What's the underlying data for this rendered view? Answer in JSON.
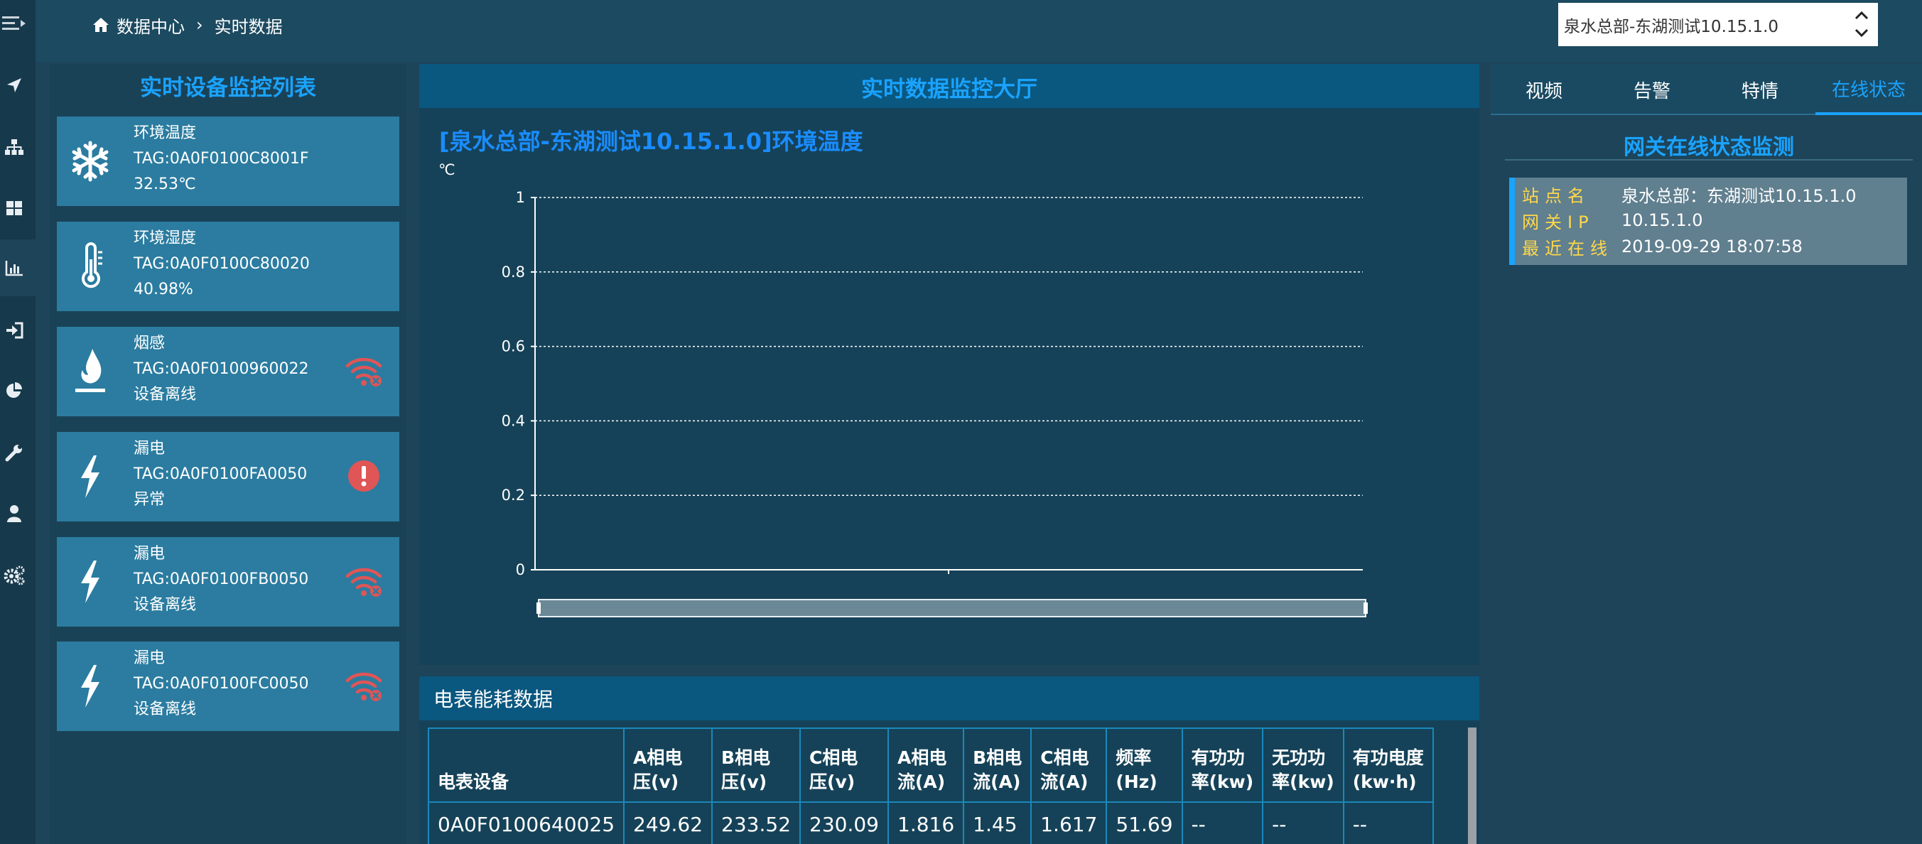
{
  "breadcrumb": {
    "home": "数据中心",
    "sep": "›",
    "current": "实时数据"
  },
  "site_select": {
    "value": "泉水总部-东湖测试10.15.1.0"
  },
  "device_list": {
    "title": "实时设备监控列表",
    "items": [
      {
        "name": "环境温度",
        "tag": "TAG:0A0F0100C8001F",
        "value": "32.53℃",
        "icon": "snowflake-icon",
        "status": ""
      },
      {
        "name": "环境湿度",
        "tag": "TAG:0A0F0100C80020",
        "value": "40.98%",
        "icon": "thermometer-icon",
        "status": ""
      },
      {
        "name": "烟感",
        "tag": "TAG:0A0F0100960022",
        "value": "设备离线",
        "icon": "flame-icon",
        "status": "wifi-off-icon"
      },
      {
        "name": "漏电",
        "tag": "TAG:0A0F0100FA0050",
        "value": "异常",
        "icon": "bolt-icon",
        "status": "alert-icon"
      },
      {
        "name": "漏电",
        "tag": "TAG:0A0F0100FB0050",
        "value": "设备离线",
        "icon": "bolt-icon",
        "status": "wifi-off-icon"
      },
      {
        "name": "漏电",
        "tag": "TAG:0A0F0100FC0050",
        "value": "设备离线",
        "icon": "bolt-icon",
        "status": "wifi-off-icon"
      }
    ]
  },
  "monitor": {
    "title": "实时数据监控大厅",
    "chart_title": "[泉水总部-东湖测试10.15.1.0]环境温度"
  },
  "chart_data": {
    "type": "line",
    "title": "",
    "ylabel": "℃",
    "xlabel": "",
    "ylim": [
      0,
      1
    ],
    "yticks": [
      "0",
      "0.2",
      "0.4",
      "0.6",
      "0.8",
      "1"
    ],
    "series": [],
    "grid": true
  },
  "meter": {
    "title": "电表能耗数据",
    "headers": [
      [
        "电表设备"
      ],
      [
        "A相电",
        "压(v)"
      ],
      [
        "B相电",
        "压(v)"
      ],
      [
        "C相电",
        "压(v)"
      ],
      [
        "A相电",
        "流(A)"
      ],
      [
        "B相电",
        "流(A)"
      ],
      [
        "C相电",
        "流(A)"
      ],
      [
        "频率",
        "(Hz)"
      ],
      [
        "有功功",
        "率(kw)"
      ],
      [
        "无功功",
        "率(kw)"
      ],
      [
        "有功电度",
        "(kw·h)"
      ]
    ],
    "rows": [
      [
        "0A0F0100640025",
        "249.62",
        "233.52",
        "230.09",
        "1.816",
        "1.45",
        "1.617",
        "51.69",
        "--",
        "--",
        "--"
      ]
    ]
  },
  "tabs": [
    {
      "label": "视频",
      "active": false
    },
    {
      "label": "告警",
      "active": false
    },
    {
      "label": "特情",
      "active": false
    },
    {
      "label": "在线状态",
      "active": true
    }
  ],
  "gateway": {
    "title": "网关在线状态监测",
    "rows": [
      {
        "key": "站点名",
        "value": "泉水总部：东湖测试10.15.1.0"
      },
      {
        "key": "网关IP",
        "value": "10.15.1.0"
      },
      {
        "key": "最近在线",
        "value": "2019-09-29 18:07:58"
      }
    ]
  },
  "colors": {
    "accent": "#1aa3ff",
    "offline": "#e05555",
    "label_yellow": "#ffd84a"
  }
}
